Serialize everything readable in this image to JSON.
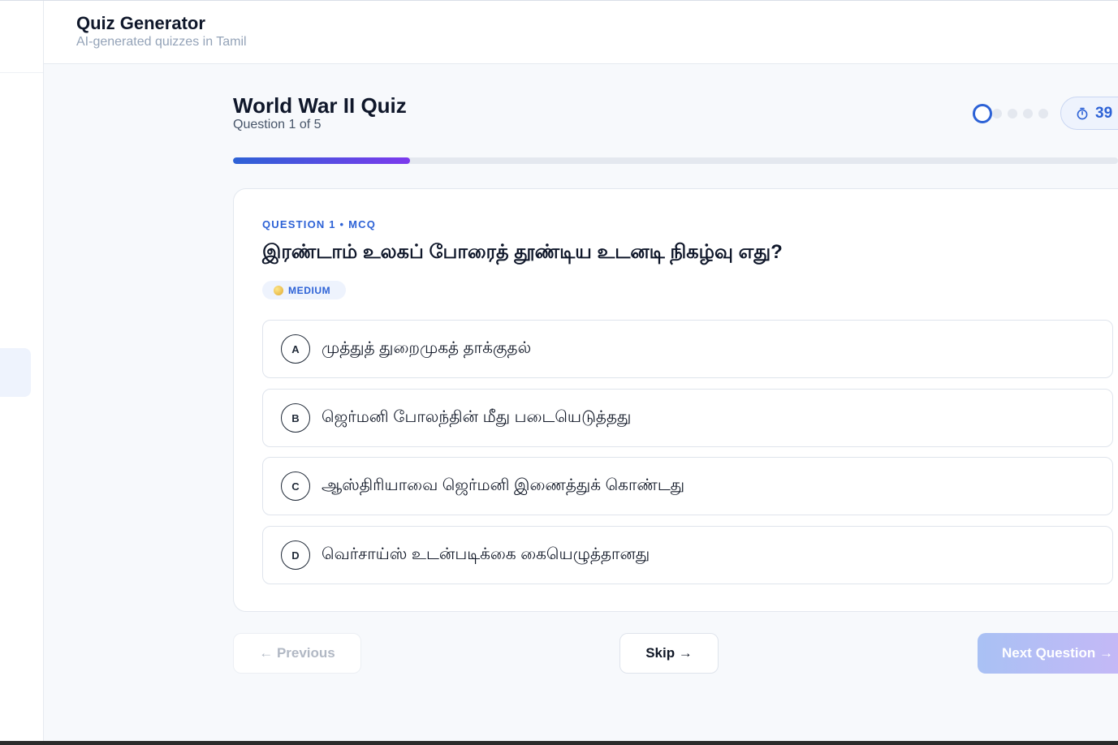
{
  "app": {
    "title": "Quiz Generator",
    "subtitle": "AI-generated quizzes in Tamil"
  },
  "quiz": {
    "title": "World War II Quiz",
    "progress_text": "Question 1 of 5",
    "current_question": 1,
    "total_questions": 5,
    "progress_fraction": 0.2,
    "timer_value": "39"
  },
  "question": {
    "meta": "QUESTION 1 • MCQ",
    "text": "இரண்டாம் உலகப் போரைத் தூண்டிய உடனடி நிகழ்வு எது?",
    "difficulty": "MEDIUM",
    "options": [
      {
        "letter": "A",
        "text": "முத்துத் துறைமுகத் தாக்குதல்"
      },
      {
        "letter": "B",
        "text": "ஜெர்மனி போலந்தின் மீது படையெடுத்தது"
      },
      {
        "letter": "C",
        "text": "ஆஸ்திரியாவை ஜெர்மனி இணைத்துக் கொண்டது"
      },
      {
        "letter": "D",
        "text": "வெர்சாய்ஸ் உடன்படிக்கை கையெழுத்தானது"
      }
    ]
  },
  "nav": {
    "previous_label": "← Previous",
    "skip_label": "Skip →",
    "next_label": "Next Question →"
  },
  "icons": {
    "timer": "stopwatch-icon",
    "difficulty": "medium-difficulty-dot-icon"
  },
  "colors": {
    "accent": "#2d62d6",
    "accent_purple": "#7c3aed",
    "text_dark": "#0f172a",
    "muted": "#94a3b8"
  }
}
